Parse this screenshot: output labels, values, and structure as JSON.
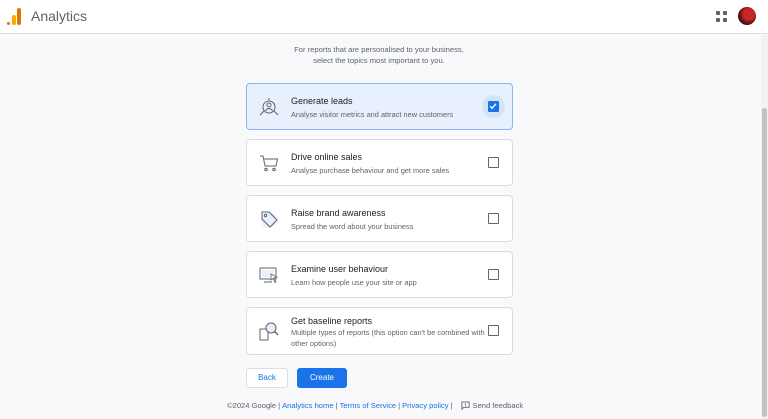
{
  "header": {
    "app_title": "Analytics",
    "apps_icon": "google-apps-icon",
    "avatar_icon": "account-avatar"
  },
  "intro": {
    "line1": "For reports that are personalised to your business,",
    "line2": "select the topics most important to you."
  },
  "options": [
    {
      "title": "Generate leads",
      "desc": "Analyse visitor metrics and attract new customers",
      "checked": true,
      "icon": "leads-target-icon"
    },
    {
      "title": "Drive online sales",
      "desc": "Analyse purchase behaviour and get more sales",
      "checked": false,
      "icon": "shopping-cart-icon"
    },
    {
      "title": "Raise brand awareness",
      "desc": "Spread the word about your business",
      "checked": false,
      "icon": "tag-icon"
    },
    {
      "title": "Examine user behaviour",
      "desc": "Learn how people use your site or app",
      "checked": false,
      "icon": "monitor-cursor-icon"
    },
    {
      "title": "Get baseline reports",
      "desc": "Multiple types of reports (this option can't be combined with other options)",
      "checked": false,
      "icon": "search-reports-icon"
    }
  ],
  "buttons": {
    "back": "Back",
    "create": "Create"
  },
  "footer": {
    "copyright": "©2024 Google",
    "sep": "|",
    "analytics_home": "Analytics home",
    "terms": "Terms of Service",
    "privacy": "Privacy policy",
    "feedback": "Send feedback"
  },
  "colors": {
    "accent": "#1a73e8",
    "selected_bg": "#e8f0fe",
    "logo_orange": "#e37400",
    "logo_yellow": "#f9ab00"
  }
}
